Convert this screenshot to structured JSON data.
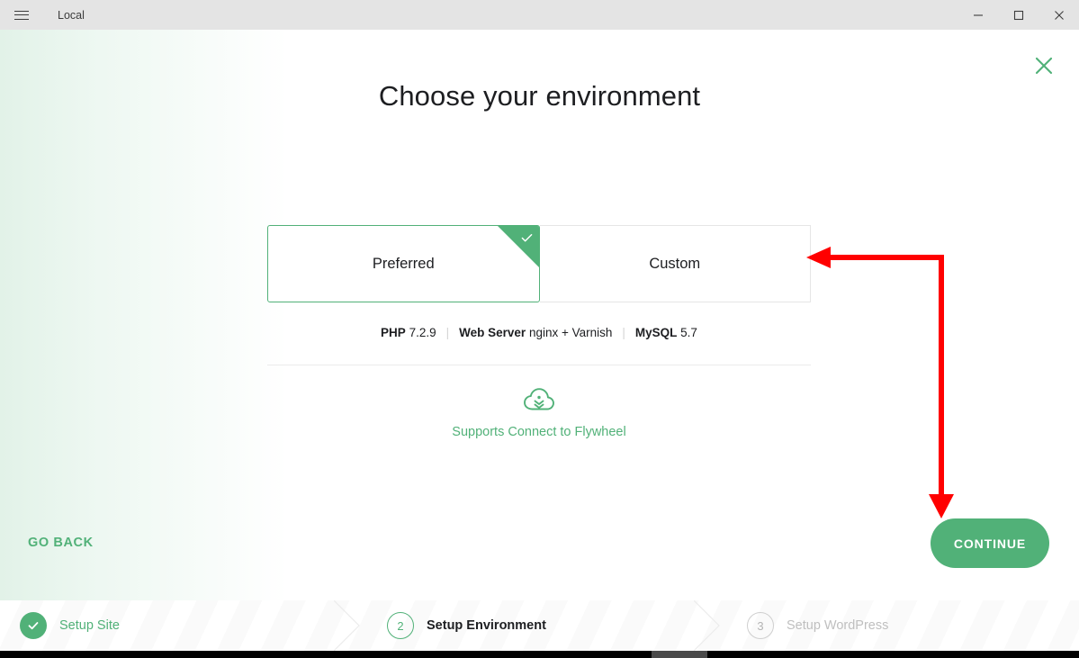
{
  "window": {
    "title": "Local",
    "menu_icon": "hamburger-icon",
    "minimize_label": "Minimize",
    "maximize_label": "Maximize",
    "close_label": "Close"
  },
  "main": {
    "page_title": "Choose your environment",
    "close_icon": "close-x-icon",
    "tabs": [
      {
        "label": "Preferred",
        "selected": true
      },
      {
        "label": "Custom",
        "selected": false
      }
    ],
    "specs": [
      {
        "label": "PHP",
        "value": "7.2.9"
      },
      {
        "label": "Web Server",
        "value": "nginx + Varnish"
      },
      {
        "label": "MySQL",
        "value": "5.7"
      }
    ],
    "separator": "|",
    "flywheel": {
      "icon": "cloud-upload-icon",
      "text": "Supports Connect to Flywheel"
    },
    "go_back_label": "GO BACK",
    "continue_label": "CONTINUE"
  },
  "steps": [
    {
      "marker": "✓",
      "label": "Setup Site",
      "state": "done"
    },
    {
      "marker": "2",
      "label": "Setup Environment",
      "state": "current"
    },
    {
      "marker": "3",
      "label": "Setup WordPress",
      "state": "todo"
    }
  ],
  "colors": {
    "brand_green": "#51b178",
    "titlebar_bg": "#e4e4e4",
    "text_dark": "#1d1e21",
    "text_muted": "#bfbfbf",
    "annotation_red": "#ff0000"
  },
  "annotation": {
    "description": "red-arrow-pointing-to-custom-tab-and-continue-button"
  }
}
